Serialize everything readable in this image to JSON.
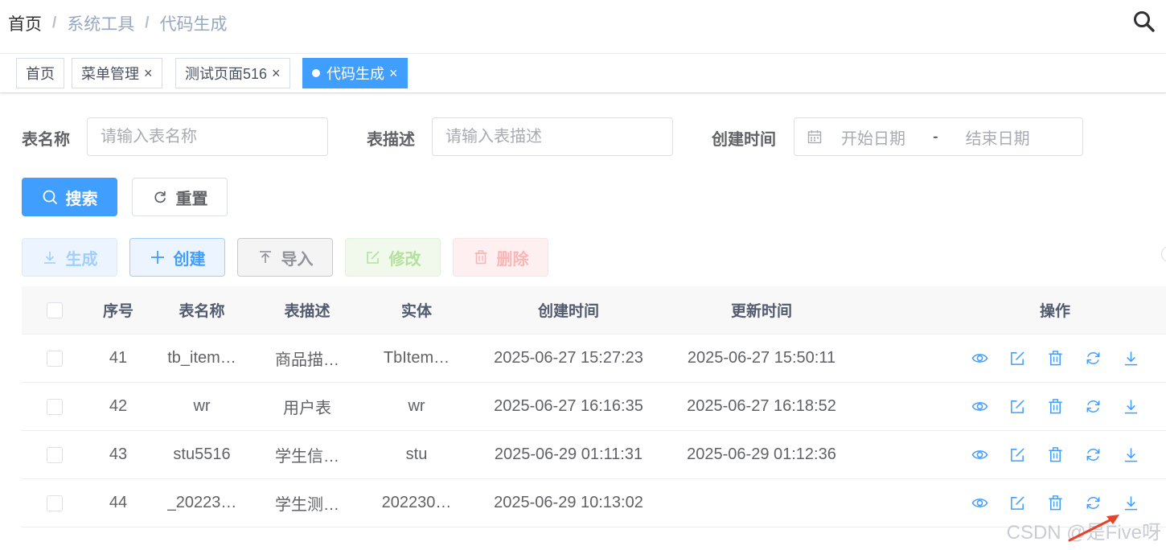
{
  "breadcrumb": [
    "首页",
    "系统工具",
    "代码生成"
  ],
  "tags": [
    {
      "label": "首页",
      "closable": false,
      "active": false
    },
    {
      "label": "菜单管理",
      "closable": true,
      "active": false
    },
    {
      "label": "测试页面516",
      "closable": true,
      "active": false
    },
    {
      "label": "代码生成",
      "closable": true,
      "active": true
    }
  ],
  "search_form": {
    "table_name_label": "表名称",
    "table_name_placeholder": "请输入表名称",
    "table_desc_label": "表描述",
    "table_desc_placeholder": "请输入表描述",
    "create_time_label": "创建时间",
    "start_placeholder": "开始日期",
    "range_separator": "-",
    "end_placeholder": "结束日期",
    "search_button": "搜索",
    "reset_button": "重置"
  },
  "toolbar": {
    "generate": "生成",
    "create": "创建",
    "import": "导入",
    "edit": "修改",
    "delete": "删除"
  },
  "table": {
    "headers": [
      "序号",
      "表名称",
      "表描述",
      "实体",
      "创建时间",
      "更新时间",
      "操作"
    ],
    "rows": [
      {
        "index": "41",
        "name": "tb_item…",
        "desc": "商品描…",
        "entity": "TbItem…",
        "created": "2025-06-27 15:27:23",
        "updated": "2025-06-27 15:50:11"
      },
      {
        "index": "42",
        "name": "wr",
        "desc": "用户表",
        "entity": "wr",
        "created": "2025-06-27 16:16:35",
        "updated": "2025-06-27 16:18:52"
      },
      {
        "index": "43",
        "name": "stu5516",
        "desc": "学生信…",
        "entity": "stu",
        "created": "2025-06-29 01:11:31",
        "updated": "2025-06-29 01:12:36"
      },
      {
        "index": "44",
        "name": "_20223…",
        "desc": "学生测…",
        "entity": "202230…",
        "created": "2025-06-29 10:13:02",
        "updated": ""
      }
    ],
    "row_actions": [
      "eye-icon",
      "edit-icon",
      "delete-icon",
      "sync-icon",
      "download-icon"
    ]
  },
  "watermark": "CSDN @是Five呀",
  "colors": {
    "primary": "#409eff",
    "success_light": "#b3e19d",
    "danger_light": "#fab6b6"
  }
}
